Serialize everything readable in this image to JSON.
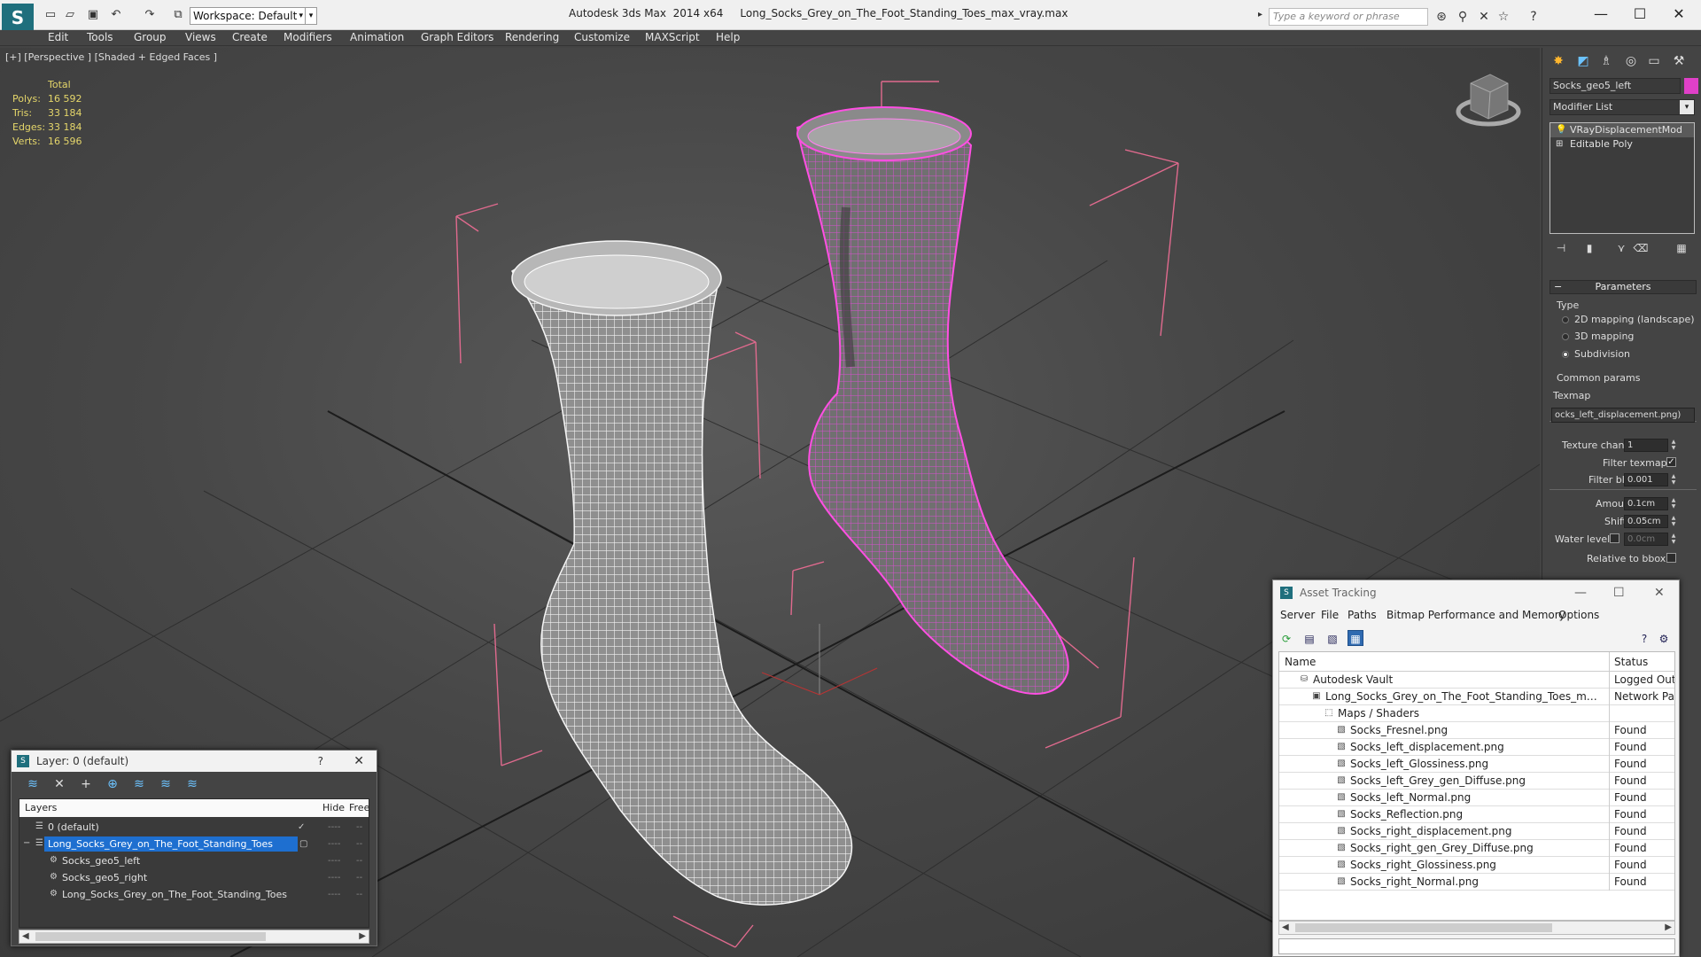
{
  "app": {
    "title_text": "Autodesk 3ds Max  2014 x64     Long_Socks_Grey_on_The_Foot_Standing_Toes_max_vray.max",
    "workspace": "Workspace: Default",
    "search_placeholder": "Type a keyword or phrase"
  },
  "menu": [
    "Edit",
    "Tools",
    "Group",
    "Views",
    "Create",
    "Modifiers",
    "Animation",
    "Graph Editors",
    "Rendering",
    "Customize",
    "MAXScript",
    "Help"
  ],
  "viewport": {
    "label": "[+] [Perspective ] [Shaded + Edged Faces ]",
    "stats_header": "Total",
    "stats": [
      {
        "label": "Polys:",
        "value": "16 592"
      },
      {
        "label": "Tris:",
        "value": "33 184"
      },
      {
        "label": "Edges:",
        "value": "33 184"
      },
      {
        "label": "Verts:",
        "value": "16 596"
      }
    ]
  },
  "command_panel": {
    "object_name": "Socks_geo5_left",
    "object_color": "#e040c8",
    "modifier_list_label": "Modifier List",
    "stack": [
      {
        "label": "VRayDisplacementMod",
        "selected": true
      },
      {
        "label": "Editable Poly",
        "selected": false
      }
    ],
    "parameters_title": "Parameters",
    "type_label": "Type",
    "type_options": [
      {
        "label": "2D mapping (landscape)",
        "selected": false
      },
      {
        "label": "3D mapping",
        "selected": false
      },
      {
        "label": "Subdivision",
        "selected": true
      }
    ],
    "common_params_label": "Common params",
    "texmap_label": "Texmap",
    "texmap_value": "ocks_left_displacement.png)",
    "texture_chan_label": "Texture chan",
    "texture_chan_value": "1",
    "filter_texmap_label": "Filter texmap",
    "filter_blur_label": "Filter blur",
    "filter_blur_value": "0.001",
    "amount_label": "Amount",
    "amount_value": "0.1cm",
    "shift_label": "Shift",
    "shift_value": "0.05cm",
    "water_level_label": "Water level",
    "water_level_value": "0.0cm",
    "relative_bbox_label": "Relative to bbox"
  },
  "layer_window": {
    "title": "Layer: 0 (default)",
    "help": "?",
    "columns": [
      "Layers",
      "Hide",
      "Free"
    ],
    "rows": [
      {
        "name": "0 (default)",
        "indent": 0,
        "selected": false
      },
      {
        "name": "Long_Socks_Grey_on_The_Foot_Standing_Toes",
        "indent": 0,
        "selected": true
      },
      {
        "name": "Socks_geo5_left",
        "indent": 1,
        "selected": false
      },
      {
        "name": "Socks_geo5_right",
        "indent": 1,
        "selected": false
      },
      {
        "name": "Long_Socks_Grey_on_The_Foot_Standing_Toes",
        "indent": 1,
        "selected": false
      }
    ]
  },
  "asset_tracking": {
    "title": "Asset Tracking",
    "menu": [
      "Server",
      "File",
      "Paths",
      "Bitmap Performance and Memory",
      "Options"
    ],
    "columns": [
      "Name",
      "Status"
    ],
    "rows": [
      {
        "name": "Autodesk Vault",
        "status": "Logged Out ...",
        "indent": 1
      },
      {
        "name": "Long_Socks_Grey_on_The_Foot_Standing_Toes_max_vray....",
        "status": "Network Path",
        "indent": 2
      },
      {
        "name": "Maps / Shaders",
        "status": "",
        "indent": 3
      },
      {
        "name": "Socks_Fresnel.png",
        "status": "Found",
        "indent": 4
      },
      {
        "name": "Socks_left_displacement.png",
        "status": "Found",
        "indent": 4
      },
      {
        "name": "Socks_left_Glossiness.png",
        "status": "Found",
        "indent": 4
      },
      {
        "name": "Socks_left_Grey_gen_Diffuse.png",
        "status": "Found",
        "indent": 4
      },
      {
        "name": "Socks_left_Normal.png",
        "status": "Found",
        "indent": 4
      },
      {
        "name": "Socks_Reflection.png",
        "status": "Found",
        "indent": 4
      },
      {
        "name": "Socks_right_displacement.png",
        "status": "Found",
        "indent": 4
      },
      {
        "name": "Socks_right_gen_Grey_Diffuse.png",
        "status": "Found",
        "indent": 4
      },
      {
        "name": "Socks_right_Glossiness.png",
        "status": "Found",
        "indent": 4
      },
      {
        "name": "Socks_right_Normal.png",
        "status": "Found",
        "indent": 4
      }
    ]
  }
}
